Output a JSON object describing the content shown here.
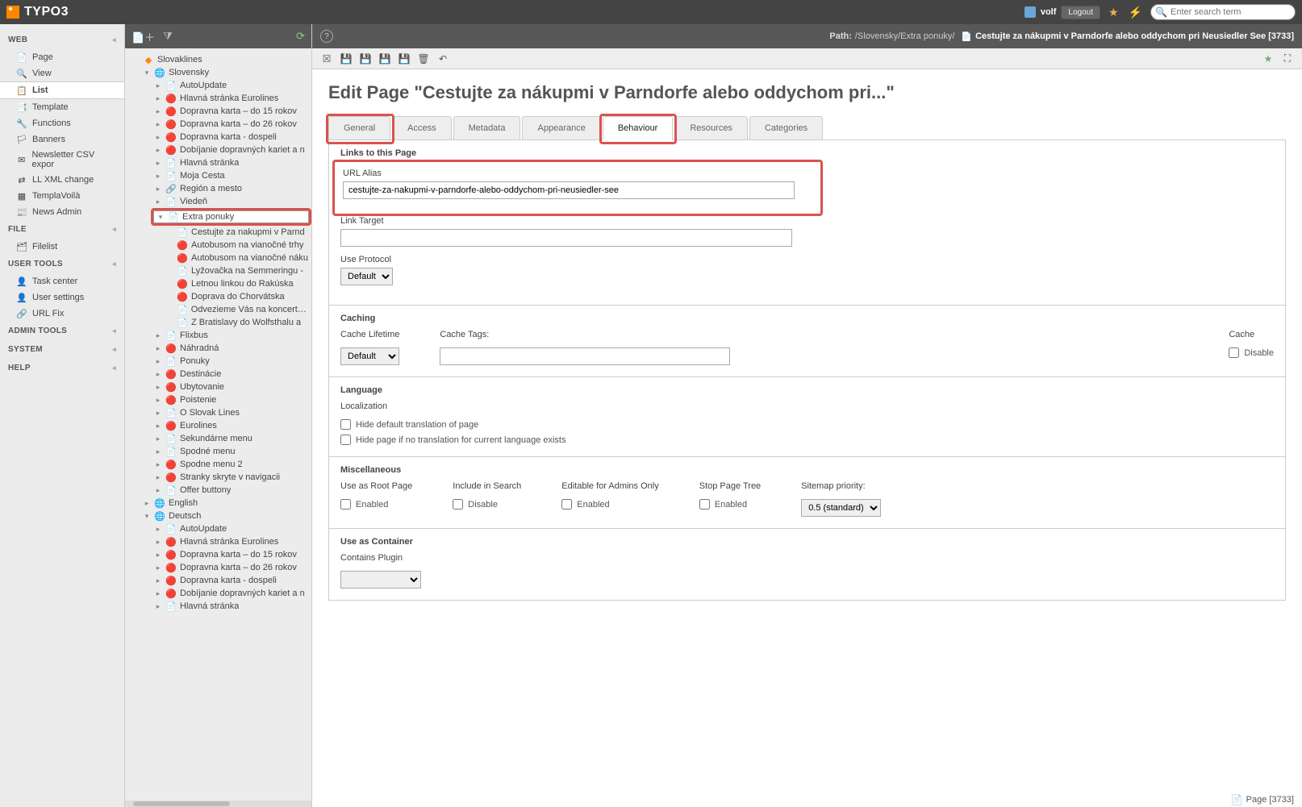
{
  "app": {
    "name": "TYPO3"
  },
  "topbar": {
    "username": "volf",
    "logout": "Logout",
    "search_placeholder": "Enter search term"
  },
  "module_menu": {
    "sections": [
      {
        "label": "WEB",
        "items": [
          {
            "label": "Page",
            "icon": "📄"
          },
          {
            "label": "View",
            "icon": "🔍"
          },
          {
            "label": "List",
            "icon": "📋",
            "active": true
          },
          {
            "label": "Template",
            "icon": "📑"
          },
          {
            "label": "Functions",
            "icon": "🔧"
          },
          {
            "label": "Banners",
            "icon": "🏳"
          },
          {
            "label": "Newsletter CSV expor",
            "icon": "✉"
          },
          {
            "label": "LL XML change",
            "icon": "⇄"
          },
          {
            "label": "TemplaVoilà",
            "icon": "▦"
          },
          {
            "label": "News Admin",
            "icon": "📰"
          }
        ]
      },
      {
        "label": "FILE",
        "items": [
          {
            "label": "Filelist",
            "icon": "🗂"
          }
        ]
      },
      {
        "label": "USER TOOLS",
        "items": [
          {
            "label": "Task center",
            "icon": "👤"
          },
          {
            "label": "User settings",
            "icon": "👤"
          },
          {
            "label": "URL Fix",
            "icon": "🔗"
          }
        ]
      },
      {
        "label": "ADMIN TOOLS",
        "items": []
      },
      {
        "label": "SYSTEM",
        "items": []
      },
      {
        "label": "HELP",
        "items": []
      }
    ]
  },
  "page_tree": {
    "root": "Slovaklines",
    "nodes": [
      {
        "label": "Slovensky",
        "icon": "🌐",
        "open": true,
        "children": [
          {
            "label": "AutoUpdate",
            "icon": "📄"
          },
          {
            "label": "Hlavná stránka Eurolines",
            "icon": "🔴"
          },
          {
            "label": "Dopravna karta – do 15 rokov",
            "icon": "🔴"
          },
          {
            "label": "Dopravna karta – do 26 rokov",
            "icon": "🔴"
          },
          {
            "label": "Dopravna karta - dospeli",
            "icon": "🔴"
          },
          {
            "label": "Dobíjanie dopravných kariet a n",
            "icon": "🔴"
          },
          {
            "label": "Hlavná stránka",
            "icon": "📄"
          },
          {
            "label": "Moja Cesta",
            "icon": "📄"
          },
          {
            "label": "Región a mesto",
            "icon": "🔗"
          },
          {
            "label": "Viedeň",
            "icon": "📄"
          },
          {
            "label": "Extra ponuky",
            "icon": "📄",
            "open": true,
            "selected": true,
            "highlight": true,
            "children": [
              {
                "label": "Cestujte za nakupmi v Parnd",
                "icon": "📄"
              },
              {
                "label": "Autobusom na vianočné trhy",
                "icon": "🔴"
              },
              {
                "label": "Autobusom na vianočné náku",
                "icon": "🔴"
              },
              {
                "label": "Lyžovačka na Semmeringu -",
                "icon": "📄"
              },
              {
                "label": "Letnou linkou do Rakúska",
                "icon": "🔴"
              },
              {
                "label": "Doprava do Chorvátska",
                "icon": "🔴"
              },
              {
                "label": "Odvezieme Vás na koncerty o",
                "icon": "📄"
              },
              {
                "label": "Z Bratislavy do Wolfsthalu a",
                "icon": "📄"
              }
            ]
          },
          {
            "label": "Flixbus",
            "icon": "📄"
          },
          {
            "label": "Náhradná",
            "icon": "🔴"
          },
          {
            "label": "Ponuky",
            "icon": "📄"
          },
          {
            "label": "Destinácie",
            "icon": "🔴"
          },
          {
            "label": "Ubytovanie",
            "icon": "🔴"
          },
          {
            "label": "Poistenie",
            "icon": "🔴"
          },
          {
            "label": "O Slovak Lines",
            "icon": "📄"
          },
          {
            "label": "Eurolines",
            "icon": "🔴"
          },
          {
            "label": "Sekundárne menu",
            "icon": "📄"
          },
          {
            "label": "Spodné menu",
            "icon": "📄"
          },
          {
            "label": "Spodne menu 2",
            "icon": "🔴"
          },
          {
            "label": "Stranky skryte v navigacii",
            "icon": "🔴"
          },
          {
            "label": "Offer buttony",
            "icon": "📄"
          }
        ]
      },
      {
        "label": "English",
        "icon": "🌐"
      },
      {
        "label": "Deutsch",
        "icon": "🌐",
        "open": true,
        "children": [
          {
            "label": "AutoUpdate",
            "icon": "📄"
          },
          {
            "label": "Hlavná stránka Eurolines",
            "icon": "🔴"
          },
          {
            "label": "Dopravna karta – do 15 rokov",
            "icon": "🔴"
          },
          {
            "label": "Dopravna karta – do 26 rokov",
            "icon": "🔴"
          },
          {
            "label": "Dopravna karta - dospeli",
            "icon": "🔴"
          },
          {
            "label": "Dobíjanie dopravných kariet a n",
            "icon": "🔴"
          },
          {
            "label": "Hlavná stránka",
            "icon": "📄"
          }
        ]
      }
    ]
  },
  "path": {
    "label": "Path:",
    "crumb": "/Slovensky/Extra ponuky/",
    "doc_title": "Cestujte za nákupmi v Parndorfe alebo oddychom pri Neusiedler See [3733]"
  },
  "edit": {
    "title": "Edit Page \"Cestujte za nákupmi v Parndorfe alebo oddychom pri...\"",
    "tabs": [
      "General",
      "Access",
      "Metadata",
      "Appearance",
      "Behaviour",
      "Resources",
      "Categories"
    ],
    "active_tab": "Behaviour",
    "sections": {
      "links": {
        "title": "Links to this Page",
        "url_alias_label": "URL Alias",
        "url_alias_value": "cestujte-za-nakupmi-v-parndorfe-alebo-oddychom-pri-neusiedler-see",
        "link_target_label": "Link Target",
        "link_target_value": "",
        "use_protocol_label": "Use Protocol",
        "use_protocol_value": "Default"
      },
      "caching": {
        "title": "Caching",
        "cache_lifetime_label": "Cache Lifetime",
        "cache_lifetime_value": "Default",
        "cache_tags_label": "Cache Tags:",
        "cache_label": "Cache",
        "cache_disable_label": "Disable"
      },
      "language": {
        "title": "Language",
        "localization_label": "Localization",
        "hide_default_label": "Hide default translation of page",
        "hide_no_trans_label": "Hide page if no translation for current language exists"
      },
      "misc": {
        "title": "Miscellaneous",
        "root_page_label": "Use as Root Page",
        "include_search_label": "Include in Search",
        "editable_admins_label": "Editable for Admins Only",
        "stop_pagetree_label": "Stop Page Tree",
        "sitemap_priority_label": "Sitemap priority:",
        "enabled_label": "Enabled",
        "disable_label": "Disable",
        "sitemap_value": "0.5 (standard)"
      },
      "container": {
        "title": "Use as Container",
        "contains_plugin_label": "Contains Plugin"
      }
    }
  },
  "footer": {
    "page_label": "Page [3733]"
  }
}
